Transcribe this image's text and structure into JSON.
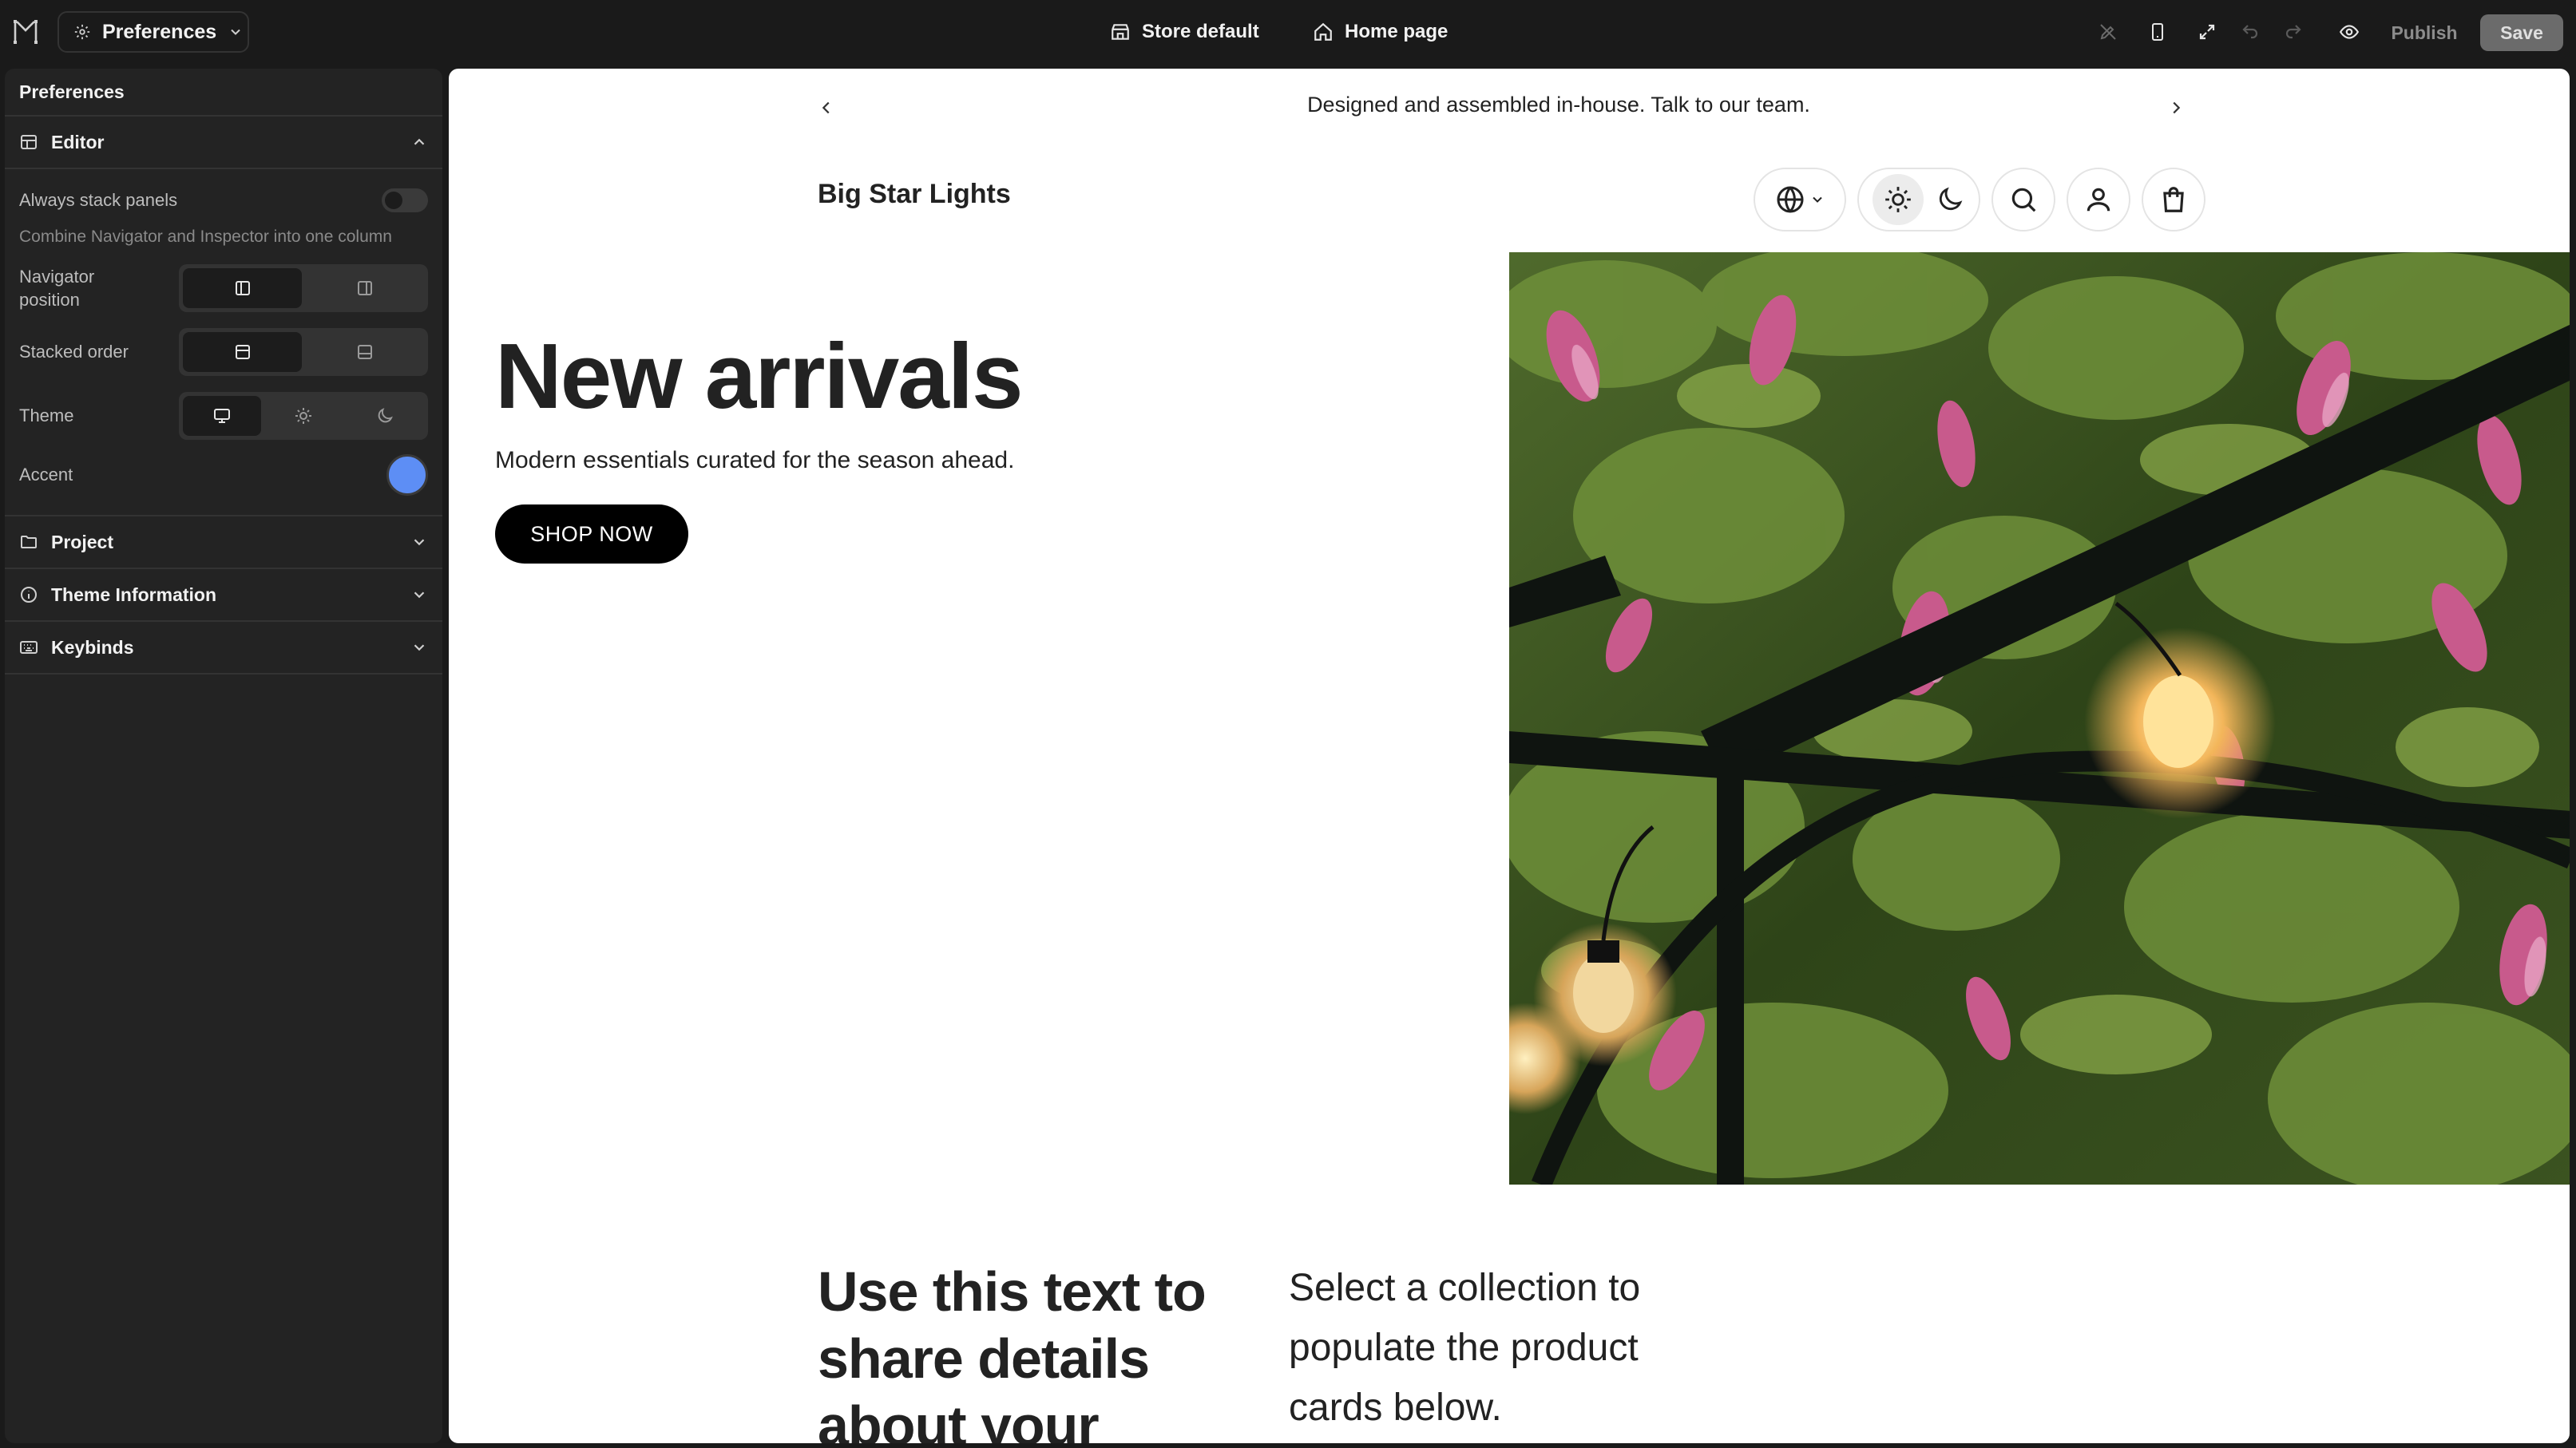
{
  "topbar": {
    "preferences_label": "Preferences",
    "store_default_label": "Store default",
    "home_page_label": "Home page",
    "publish_label": "Publish",
    "save_label": "Save"
  },
  "sidebar": {
    "title": "Preferences",
    "editor": {
      "heading": "Editor",
      "always_stack_label": "Always stack panels",
      "always_stack_desc": "Combine Navigator and Inspector into one column",
      "always_stack_on": false,
      "navigator_position_label": "Navigator position",
      "navigator_position_selected": "left",
      "stacked_order_label": "Stacked order",
      "stacked_order_selected": "top",
      "theme_label": "Theme",
      "theme_selected": "system",
      "accent_label": "Accent",
      "accent_color": "#5d8ef5"
    },
    "sections": [
      {
        "label": "Project",
        "icon": "folder-icon"
      },
      {
        "label": "Theme Information",
        "icon": "info-icon"
      },
      {
        "label": "Keybinds",
        "icon": "keyboard-icon"
      }
    ]
  },
  "preview": {
    "announcement": "Designed and assembled in-house. Talk to our team.",
    "store_name": "Big Star Lights",
    "hero_title": "New arrivals",
    "hero_subtitle": "Modern essentials curated for the season ahead.",
    "hero_button": "SHOP NOW",
    "text_left": "Use this text to share details about your",
    "text_right": "Select a collection to populate the product cards below."
  }
}
